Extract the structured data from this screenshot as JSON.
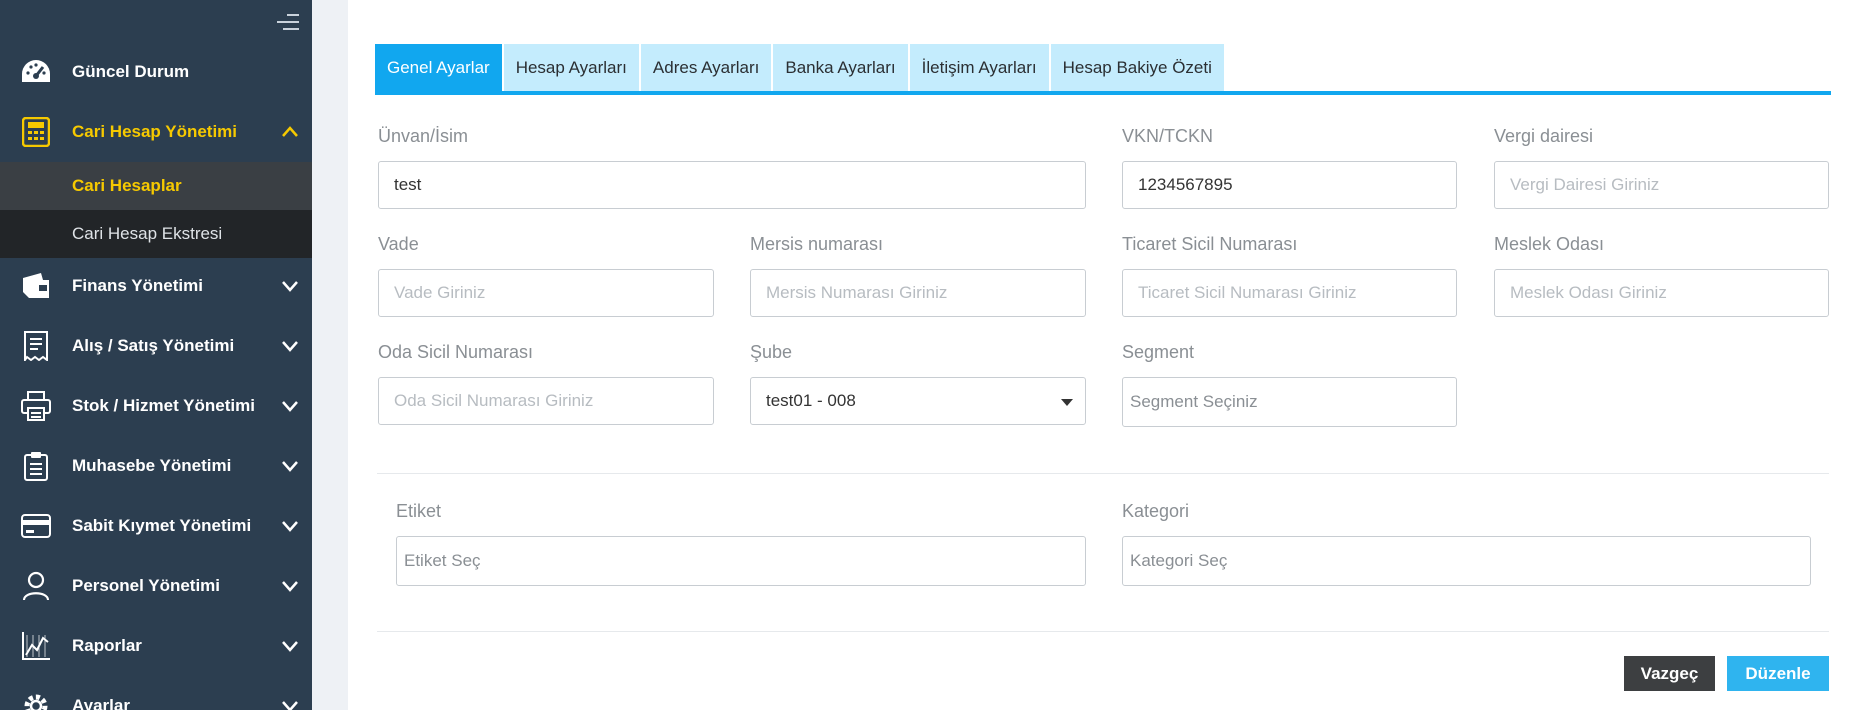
{
  "sidebar": {
    "menu_icon": "hamburger-icon",
    "items": [
      {
        "label": "Güncel Durum",
        "icon": "dashboard-icon"
      },
      {
        "label": "Cari Hesap Yönetimi",
        "icon": "calculator-icon",
        "active": true
      },
      {
        "label": "Finans Yönetimi",
        "icon": "wallet-icon"
      },
      {
        "label": "Alış / Satış Yönetimi",
        "icon": "receipt-icon"
      },
      {
        "label": "Stok / Hizmet Yönetimi",
        "icon": "printer-icon"
      },
      {
        "label": "Muhasebe Yönetimi",
        "icon": "clipboard-icon"
      },
      {
        "label": "Sabit Kıymet Yönetimi",
        "icon": "credit-card-icon"
      },
      {
        "label": "Personel Yönetimi",
        "icon": "user-icon"
      },
      {
        "label": "Raporlar",
        "icon": "chart-icon"
      },
      {
        "label": "Ayarlar",
        "icon": "gear-icon"
      }
    ],
    "sub_items": [
      {
        "label": "Cari Hesaplar",
        "active": true
      },
      {
        "label": "Cari Hesap Ekstresi"
      }
    ]
  },
  "tabs": [
    {
      "label": "Genel Ayarlar",
      "active": true
    },
    {
      "label": "Hesap Ayarları"
    },
    {
      "label": "Adres Ayarları"
    },
    {
      "label": "Banka Ayarları"
    },
    {
      "label": "İletişim Ayarları"
    },
    {
      "label": "Hesap Bakiye Özeti"
    }
  ],
  "form": {
    "unvan": {
      "label": "Ünvan/İsim",
      "value": "test"
    },
    "vkn": {
      "label": "VKN/TCKN",
      "value": "1234567895"
    },
    "vergi_dairesi": {
      "label": "Vergi dairesi",
      "placeholder": "Vergi Dairesi Giriniz"
    },
    "vade": {
      "label": "Vade",
      "placeholder": "Vade Giriniz"
    },
    "mersis": {
      "label": "Mersis numarası",
      "placeholder": "Mersis Numarası Giriniz"
    },
    "ticaret_sicil": {
      "label": "Ticaret Sicil Numarası",
      "placeholder": "Ticaret Sicil Numarası Giriniz"
    },
    "meslek_odasi": {
      "label": "Meslek Odası",
      "placeholder": "Meslek Odası Giriniz"
    },
    "oda_sicil": {
      "label": "Oda Sicil Numarası",
      "placeholder": "Oda Sicil Numarası Giriniz"
    },
    "sube": {
      "label": "Şube",
      "value": "test01 - 008"
    },
    "segment": {
      "label": "Segment",
      "placeholder": "Segment Seçiniz"
    },
    "etiket": {
      "label": "Etiket",
      "placeholder": "Etiket Seç"
    },
    "kategori": {
      "label": "Kategori",
      "placeholder": "Kategori Seç"
    }
  },
  "buttons": {
    "cancel": "Vazgeç",
    "save": "Düzenle"
  },
  "colors": {
    "sidebar_bg": "#2c3e50",
    "accent": "#11a7ef",
    "active_text": "#f6c900"
  }
}
